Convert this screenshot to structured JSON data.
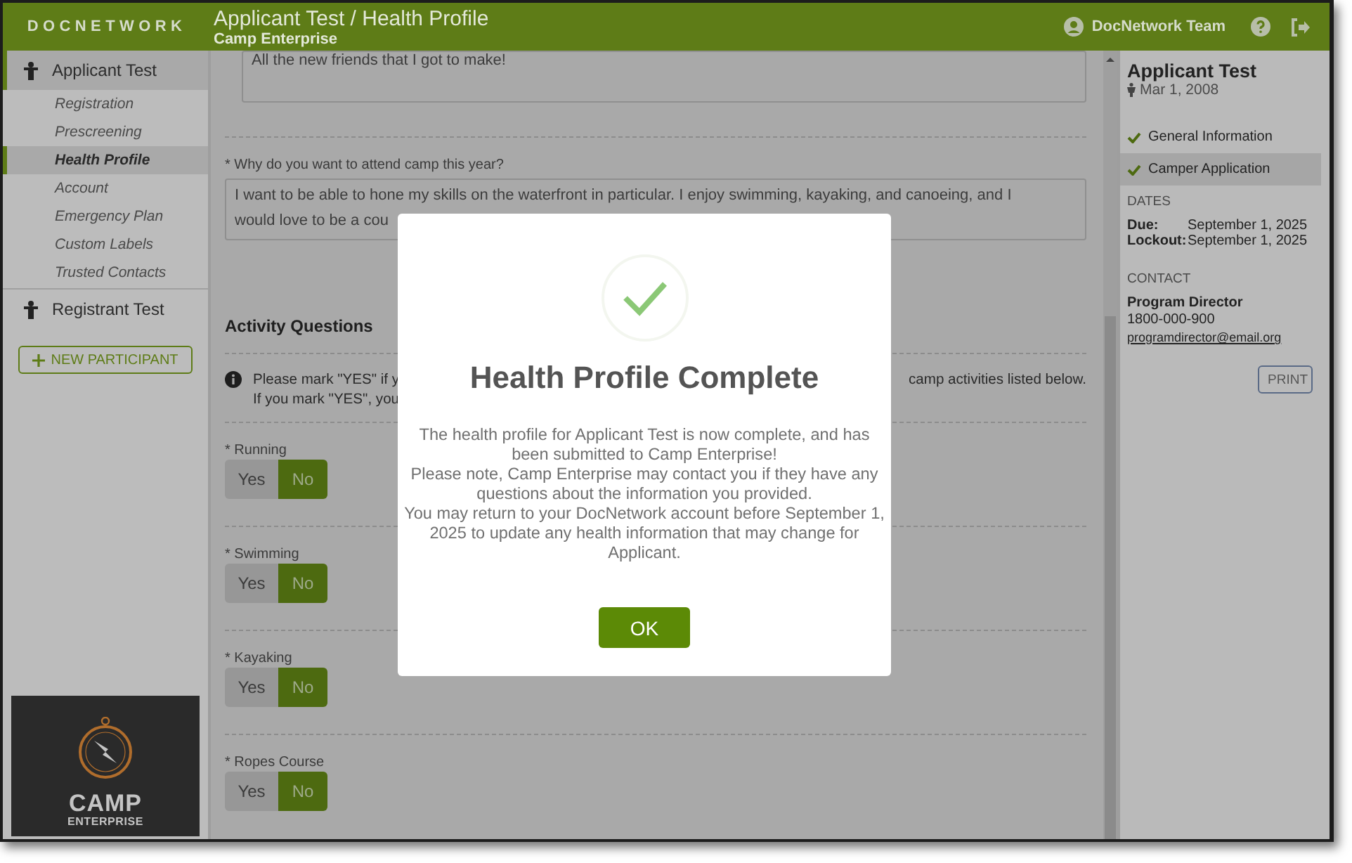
{
  "header": {
    "logo": "DOCNETWORK",
    "title": "Applicant Test / Health Profile",
    "subtitle": "Camp Enterprise",
    "user": "DocNetwork Team"
  },
  "sidebar": {
    "participants": [
      {
        "name": "Applicant Test",
        "selected": true,
        "children": [
          {
            "label": "Registration",
            "selected": false
          },
          {
            "label": "Prescreening",
            "selected": false
          },
          {
            "label": "Health Profile",
            "selected": true
          },
          {
            "label": "Account",
            "selected": false
          },
          {
            "label": "Emergency Plan",
            "selected": false
          },
          {
            "label": "Custom Labels",
            "selected": false
          },
          {
            "label": "Trusted Contacts",
            "selected": false
          }
        ]
      },
      {
        "name": "Registrant Test",
        "selected": false
      }
    ],
    "new_participant_button": "NEW PARTICIPANT",
    "logo": {
      "title": "CAMP",
      "subtitle": "ENTERPRISE"
    }
  },
  "form": {
    "previous_answer": "All the new friends that I got to make!",
    "question": {
      "label": "* Why do you want to attend camp this year?",
      "answer_lines": [
        "I want to be able to hone my skills on the waterfront in particular. I enjoy swimming, kayaking, and canoeing, and I",
        "would love to be a cou"
      ]
    },
    "section_title": "Activity Questions",
    "info": {
      "line_1_start": "Please mark \"YES\" if y",
      "line_1_end": "camp activities listed below.",
      "line_2_start": "If you mark \"YES\", you"
    },
    "activities": [
      {
        "label": "* Running",
        "options": [
          {
            "label": "Yes",
            "selected": false
          },
          {
            "label": "No",
            "selected": true
          }
        ]
      },
      {
        "label": "* Swimming",
        "options": [
          {
            "label": "Yes",
            "selected": false
          },
          {
            "label": "No",
            "selected": true
          }
        ]
      },
      {
        "label": "* Kayaking",
        "options": [
          {
            "label": "Yes",
            "selected": false
          },
          {
            "label": "No",
            "selected": true
          }
        ]
      },
      {
        "label": "* Ropes Course",
        "options": [
          {
            "label": "Yes",
            "selected": false
          },
          {
            "label": "No",
            "selected": true
          }
        ]
      }
    ]
  },
  "panel": {
    "name": "Applicant Test",
    "birthdate": "Mar 1, 2008",
    "steps": [
      {
        "label": "General Information",
        "complete": true,
        "selected": false
      },
      {
        "label": "Camper Application",
        "complete": true,
        "selected": true
      }
    ],
    "dates_heading": "DATES",
    "dates": [
      {
        "label": "Due:",
        "value": "September 1, 2025"
      },
      {
        "label": "Lockout:",
        "value": "September 1, 2025"
      }
    ],
    "contact_heading": "CONTACT",
    "contact": {
      "name": "Program Director",
      "phone": "1800-000-900",
      "email": "programdirector@email.org"
    },
    "print_button": "PRINT"
  },
  "modal": {
    "title": "Health Profile Complete",
    "paragraphs": [
      "The health profile for Applicant Test is now complete, and has been submitted to Camp Enterprise!",
      "Please note, Camp Enterprise may contact you if they have any questions about the information you provided.",
      "You may return to your DocNetwork account before September 1, 2025 to update any health information that may change for Applicant."
    ],
    "button": "OK"
  }
}
